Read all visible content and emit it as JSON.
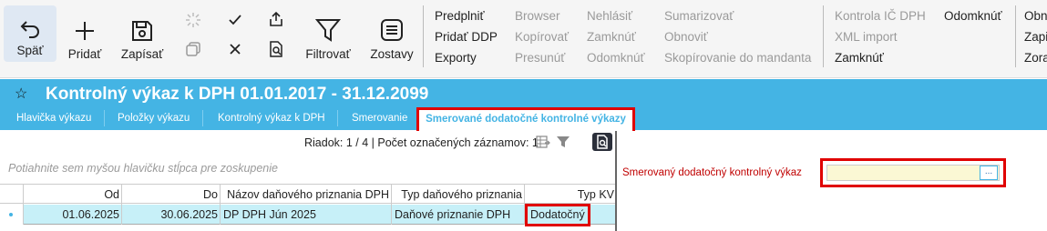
{
  "toolbar": {
    "back": "Späť",
    "add": "Pridať",
    "save": "Zapísať",
    "filter": "Filtrovať",
    "reports": "Zostavy"
  },
  "menu": {
    "col1": [
      "Predplniť",
      "Pridať DDP",
      "Exporty"
    ],
    "col2": [
      "Browser",
      "Kopírovať",
      "Presunúť"
    ],
    "col3": [
      "Nehlásiť",
      "Zamknúť",
      "Odomknúť"
    ],
    "col4": [
      "Sumarizovať",
      "Obnoviť",
      "Skopírovanie do mandanta"
    ],
    "col5": [
      "Kontrola IČ DPH",
      "XML import",
      "Zamknúť"
    ],
    "col6": [
      "Odomknúť"
    ],
    "col7": [
      "Obn",
      "Zapi",
      "Zora"
    ]
  },
  "title": {
    "text": "Kontrolný výkaz k DPH 01.01.2017 - 31.12.2099"
  },
  "tabs": [
    "Hlavička výkazu",
    "Položky výkazu",
    "Kontrolný výkaz k DPH",
    "Smerovanie",
    "Smerované dodatočné kontrolné výkazy"
  ],
  "grid": {
    "status": "Riadok: 1 / 4 | Počet označených záznamov: 1",
    "group_hint": "Potiahnite sem myšou hlavičku stĺpca pre zoskupenie",
    "columns": [
      "Od",
      "Do",
      "Názov daňového priznania DPH",
      "Typ daňového priznania",
      "Typ KV"
    ],
    "rows": [
      [
        "01.06.2025",
        "30.06.2025",
        "DP DPH Jún 2025",
        "Daňové priznanie DPH",
        "Dodatočný"
      ]
    ]
  },
  "form": {
    "label": "Smerovaný dodatočný kontrolný výkaz",
    "value": "",
    "lookup_button": "..."
  },
  "colors": {
    "accent": "#44b4e4",
    "highlight": "#e00000",
    "row_selected": "#c7f0f8",
    "input_bg": "#fbf8d4"
  }
}
